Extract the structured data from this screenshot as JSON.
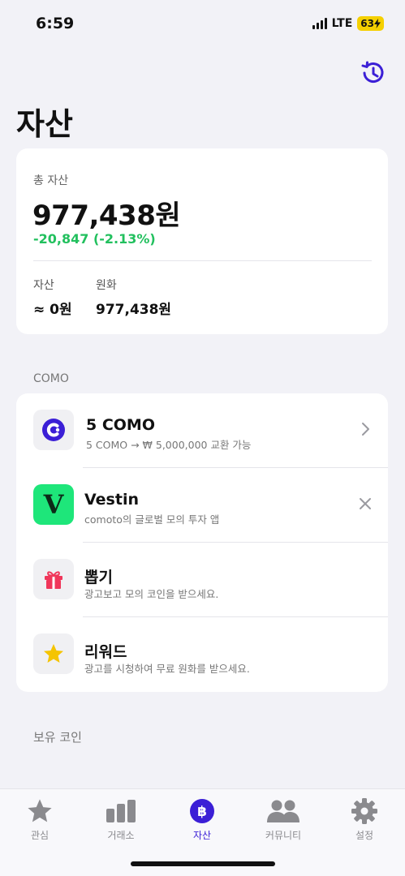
{
  "status": {
    "time": "6:59",
    "network": "LTE",
    "battery": "63"
  },
  "page": {
    "title": "자산"
  },
  "summary": {
    "total_label": "총 자산",
    "total_value": "977,438원",
    "change": "-20,847 (-2.13%)",
    "assets_label": "자산",
    "assets_value": "≈ 0원",
    "krw_label": "원화",
    "krw_value": "977,438원"
  },
  "como_section": {
    "label": "COMO",
    "items": [
      {
        "title": "5 COMO",
        "subtitle": "5 COMO → ₩ 5,000,000 교환 가능",
        "icon": "como-logo-icon",
        "action": "chevron-right-icon"
      },
      {
        "title": "Vestin",
        "subtitle": "comoto의 글로벌 모의 투자 앱",
        "icon": "vestin-logo-icon",
        "icon_letter": "V",
        "action": "close-icon"
      },
      {
        "title": "뽑기",
        "subtitle": "광고보고 모의 코인을 받으세요.",
        "icon": "gift-icon"
      },
      {
        "title": "리워드",
        "subtitle": "광고를 시청하여 무료 원화를 받으세요.",
        "icon": "star-icon"
      }
    ]
  },
  "holdings_section": {
    "label": "보유 코인"
  },
  "tabs": [
    {
      "label": "관심",
      "icon": "star-icon",
      "active": false
    },
    {
      "label": "거래소",
      "icon": "bar-chart-icon",
      "active": false
    },
    {
      "label": "자산",
      "icon": "bitcoin-icon",
      "active": true
    },
    {
      "label": "커뮤니티",
      "icon": "people-icon",
      "active": false
    },
    {
      "label": "설정",
      "icon": "gear-icon",
      "active": false
    }
  ],
  "colors": {
    "accent": "#3b1fd6",
    "positive_change": "#22c05e",
    "vestin_bg": "#1ee67a",
    "gift": "#f0365a",
    "star": "#f5c400"
  }
}
